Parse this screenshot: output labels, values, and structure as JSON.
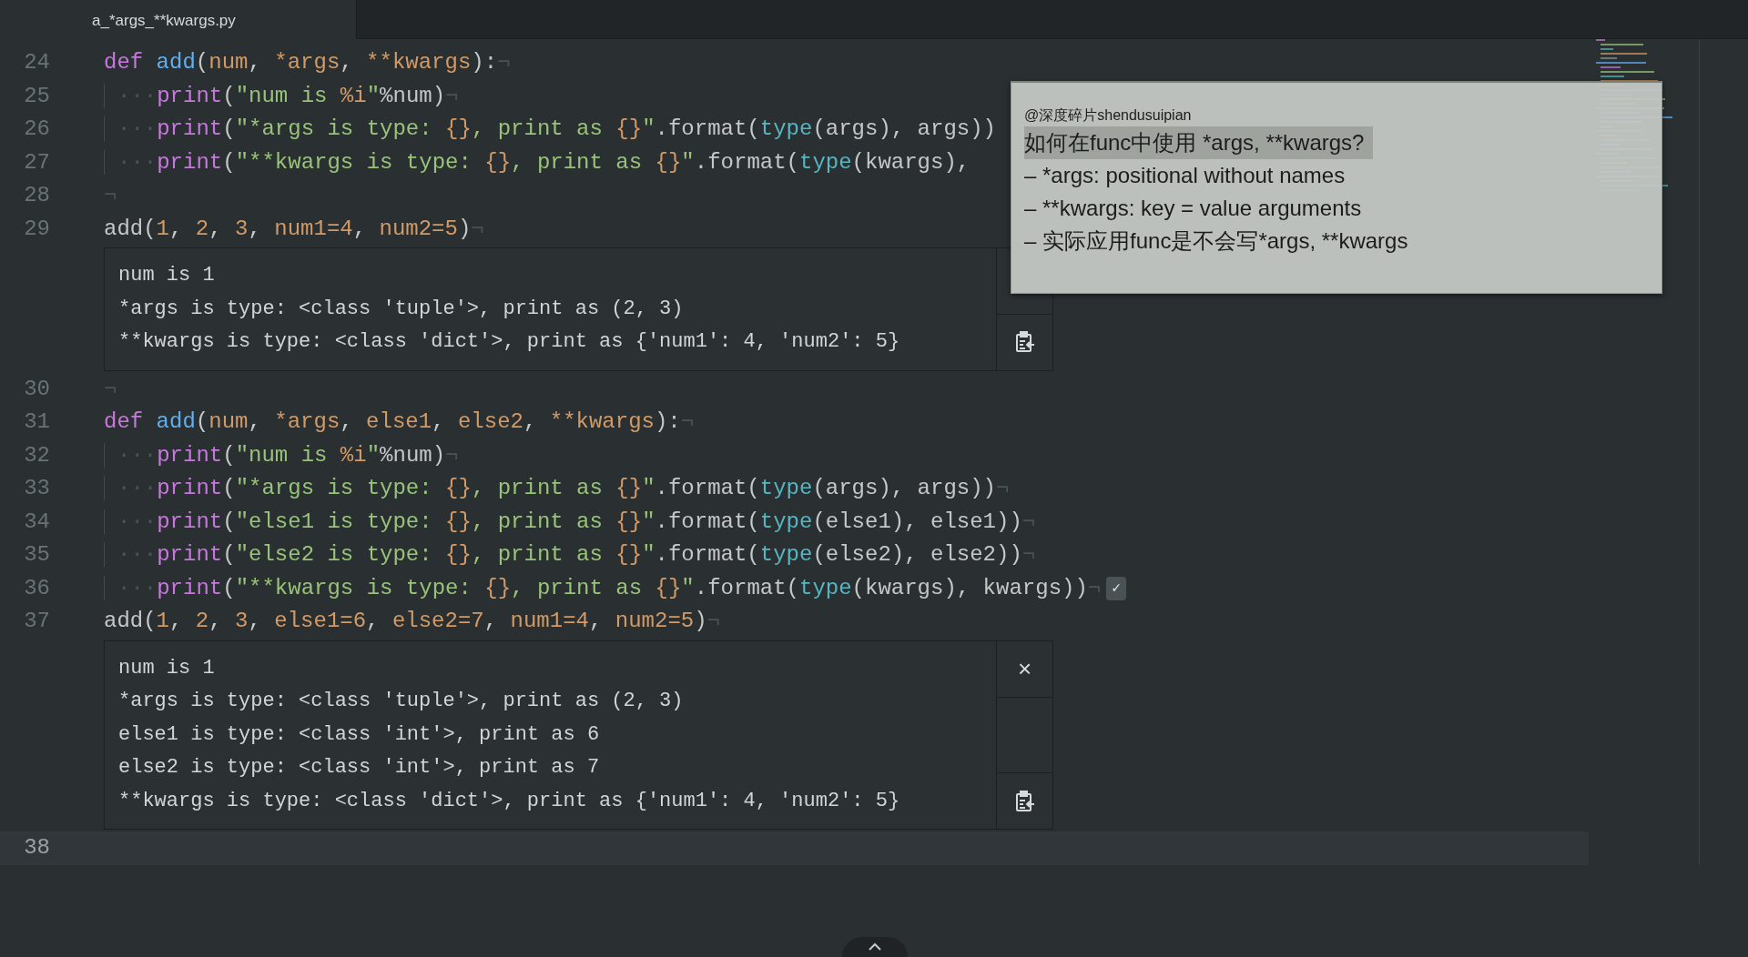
{
  "tabs": [
    {
      "title": "a_*args_**kwargs.py",
      "selected": true
    }
  ],
  "editor": {
    "lines": [
      {
        "kind": "code",
        "number": "24",
        "cursor": false,
        "tokens": [
          {
            "kind": "keyword",
            "text": "def "
          },
          {
            "kind": "function",
            "text": "add"
          },
          {
            "kind": "plain",
            "text": "("
          },
          {
            "kind": "param",
            "text": "num"
          },
          {
            "kind": "plain",
            "text": ", "
          },
          {
            "kind": "param",
            "text": "*args"
          },
          {
            "kind": "plain",
            "text": ", "
          },
          {
            "kind": "param",
            "text": "**kwargs"
          },
          {
            "kind": "plain",
            "text": "):"
          }
        ],
        "eol": "¬"
      },
      {
        "kind": "code",
        "number": "25",
        "cursor": false,
        "indent": "···",
        "tokens": [
          {
            "kind": "call",
            "text": "print"
          },
          {
            "kind": "plain",
            "text": "("
          },
          {
            "kind": "string",
            "text": "\"num is "
          },
          {
            "kind": "number",
            "text": "%i"
          },
          {
            "kind": "string",
            "text": "\""
          },
          {
            "kind": "plain",
            "text": "%num)"
          }
        ],
        "eol": "¬"
      },
      {
        "kind": "code",
        "number": "26",
        "cursor": false,
        "indent": "···",
        "tokens": [
          {
            "kind": "call",
            "text": "print"
          },
          {
            "kind": "plain",
            "text": "("
          },
          {
            "kind": "string",
            "text": "\"*args is type: "
          },
          {
            "kind": "number",
            "text": "{}"
          },
          {
            "kind": "string",
            "text": ", print as "
          },
          {
            "kind": "number",
            "text": "{}"
          },
          {
            "kind": "string",
            "text": "\""
          },
          {
            "kind": "plain",
            "text": ".format("
          },
          {
            "kind": "builtin",
            "text": "type"
          },
          {
            "kind": "plain",
            "text": "(args), args))"
          }
        ]
      },
      {
        "kind": "code",
        "number": "27",
        "cursor": false,
        "indent": "···",
        "tokens": [
          {
            "kind": "call",
            "text": "print"
          },
          {
            "kind": "plain",
            "text": "("
          },
          {
            "kind": "string",
            "text": "\"**kwargs is type: "
          },
          {
            "kind": "number",
            "text": "{}"
          },
          {
            "kind": "string",
            "text": ", print as "
          },
          {
            "kind": "number",
            "text": "{}"
          },
          {
            "kind": "string",
            "text": "\""
          },
          {
            "kind": "plain",
            "text": ".format("
          },
          {
            "kind": "builtin",
            "text": "type"
          },
          {
            "kind": "plain",
            "text": "(kwargs),"
          }
        ]
      },
      {
        "kind": "code",
        "number": "28",
        "cursor": false,
        "eol": "¬"
      },
      {
        "kind": "code",
        "number": "29",
        "cursor": false,
        "tokens": [
          {
            "kind": "plain",
            "text": "add("
          },
          {
            "kind": "number",
            "text": "1"
          },
          {
            "kind": "plain",
            "text": ", "
          },
          {
            "kind": "number",
            "text": "2"
          },
          {
            "kind": "plain",
            "text": ", "
          },
          {
            "kind": "number",
            "text": "3"
          },
          {
            "kind": "plain",
            "text": ", "
          },
          {
            "kind": "param",
            "text": "num1="
          },
          {
            "kind": "number",
            "text": "4"
          },
          {
            "kind": "plain",
            "text": ", "
          },
          {
            "kind": "param",
            "text": "num2="
          },
          {
            "kind": "number",
            "text": "5"
          },
          {
            "kind": "plain",
            "text": ")"
          }
        ],
        "eol": "¬"
      },
      {
        "kind": "output",
        "lines": [
          "num is 1",
          "*args is type: <class 'tuple'>, print as (2, 3)",
          "**kwargs is type: <class 'dict'>, print as {'num1': 4, 'num2': 5}"
        ]
      },
      {
        "kind": "code",
        "number": "30",
        "cursor": false,
        "eol": "¬"
      },
      {
        "kind": "code",
        "number": "31",
        "cursor": false,
        "tokens": [
          {
            "kind": "keyword",
            "text": "def "
          },
          {
            "kind": "function",
            "text": "add"
          },
          {
            "kind": "plain",
            "text": "("
          },
          {
            "kind": "param",
            "text": "num"
          },
          {
            "kind": "plain",
            "text": ", "
          },
          {
            "kind": "param",
            "text": "*args"
          },
          {
            "kind": "plain",
            "text": ", "
          },
          {
            "kind": "param",
            "text": "else1"
          },
          {
            "kind": "plain",
            "text": ", "
          },
          {
            "kind": "param",
            "text": "else2"
          },
          {
            "kind": "plain",
            "text": ", "
          },
          {
            "kind": "param",
            "text": "**kwargs"
          },
          {
            "kind": "plain",
            "text": "):"
          }
        ],
        "eol": "¬"
      },
      {
        "kind": "code",
        "number": "32",
        "cursor": false,
        "indent": "···",
        "tokens": [
          {
            "kind": "call",
            "text": "print"
          },
          {
            "kind": "plain",
            "text": "("
          },
          {
            "kind": "string",
            "text": "\"num is "
          },
          {
            "kind": "number",
            "text": "%i"
          },
          {
            "kind": "string",
            "text": "\""
          },
          {
            "kind": "plain",
            "text": "%num)"
          }
        ],
        "eol": "¬"
      },
      {
        "kind": "code",
        "number": "33",
        "cursor": false,
        "indent": "···",
        "tokens": [
          {
            "kind": "call",
            "text": "print"
          },
          {
            "kind": "plain",
            "text": "("
          },
          {
            "kind": "string",
            "text": "\"*args is type: "
          },
          {
            "kind": "number",
            "text": "{}"
          },
          {
            "kind": "string",
            "text": ", print as "
          },
          {
            "kind": "number",
            "text": "{}"
          },
          {
            "kind": "string",
            "text": "\""
          },
          {
            "kind": "plain",
            "text": ".format("
          },
          {
            "kind": "builtin",
            "text": "type"
          },
          {
            "kind": "plain",
            "text": "(args), args))"
          }
        ],
        "eol": "¬"
      },
      {
        "kind": "code",
        "number": "34",
        "cursor": false,
        "indent": "···",
        "tokens": [
          {
            "kind": "call",
            "text": "print"
          },
          {
            "kind": "plain",
            "text": "("
          },
          {
            "kind": "string",
            "text": "\"else1 is type: "
          },
          {
            "kind": "number",
            "text": "{}"
          },
          {
            "kind": "string",
            "text": ", print as "
          },
          {
            "kind": "number",
            "text": "{}"
          },
          {
            "kind": "string",
            "text": "\""
          },
          {
            "kind": "plain",
            "text": ".format("
          },
          {
            "kind": "builtin",
            "text": "type"
          },
          {
            "kind": "plain",
            "text": "(else1), else1))"
          }
        ],
        "eol": "¬"
      },
      {
        "kind": "code",
        "number": "35",
        "cursor": false,
        "indent": "···",
        "tokens": [
          {
            "kind": "call",
            "text": "print"
          },
          {
            "kind": "plain",
            "text": "("
          },
          {
            "kind": "string",
            "text": "\"else2 is type: "
          },
          {
            "kind": "number",
            "text": "{}"
          },
          {
            "kind": "string",
            "text": ", print as "
          },
          {
            "kind": "number",
            "text": "{}"
          },
          {
            "kind": "string",
            "text": "\""
          },
          {
            "kind": "plain",
            "text": ".format("
          },
          {
            "kind": "builtin",
            "text": "type"
          },
          {
            "kind": "plain",
            "text": "(else2), else2))"
          }
        ],
        "eol": "¬"
      },
      {
        "kind": "code",
        "number": "36",
        "cursor": false,
        "indent": "···",
        "tokens": [
          {
            "kind": "call",
            "text": "print"
          },
          {
            "kind": "plain",
            "text": "("
          },
          {
            "kind": "string",
            "text": "\"**kwargs is type: "
          },
          {
            "kind": "number",
            "text": "{}"
          },
          {
            "kind": "string",
            "text": ", print as "
          },
          {
            "kind": "number",
            "text": "{}"
          },
          {
            "kind": "string",
            "text": "\""
          },
          {
            "kind": "plain",
            "text": ".format("
          },
          {
            "kind": "builtin",
            "text": "type"
          },
          {
            "kind": "plain",
            "text": "(kwargs), kwargs))"
          }
        ],
        "eol": "¬",
        "run_mark": "✓"
      },
      {
        "kind": "code",
        "number": "37",
        "cursor": false,
        "tokens": [
          {
            "kind": "plain",
            "text": "add("
          },
          {
            "kind": "number",
            "text": "1"
          },
          {
            "kind": "plain",
            "text": ", "
          },
          {
            "kind": "number",
            "text": "2"
          },
          {
            "kind": "plain",
            "text": ", "
          },
          {
            "kind": "number",
            "text": "3"
          },
          {
            "kind": "plain",
            "text": ", "
          },
          {
            "kind": "param",
            "text": "else1="
          },
          {
            "kind": "number",
            "text": "6"
          },
          {
            "kind": "plain",
            "text": ", "
          },
          {
            "kind": "param",
            "text": "else2="
          },
          {
            "kind": "number",
            "text": "7"
          },
          {
            "kind": "plain",
            "text": ", "
          },
          {
            "kind": "param",
            "text": "num1="
          },
          {
            "kind": "number",
            "text": "4"
          },
          {
            "kind": "plain",
            "text": ", "
          },
          {
            "kind": "param",
            "text": "num2="
          },
          {
            "kind": "number",
            "text": "5"
          },
          {
            "kind": "plain",
            "text": ")"
          }
        ],
        "eol": "¬"
      },
      {
        "kind": "output",
        "close": "×",
        "lines": [
          "num is 1",
          "*args is type: <class 'tuple'>, print as (2, 3)",
          "else1 is type: <class 'int'>, print as 6",
          "else2 is type: <class 'int'>, print as 7",
          "**kwargs is type: <class 'dict'>, print as {'num1': 4, 'num2': 5}"
        ]
      },
      {
        "kind": "code",
        "number": "38",
        "cursor": true
      }
    ]
  },
  "note": {
    "handle": "@深度碎片shendusuipian",
    "lines": [
      {
        "text": "如何在func中使用 *args, **kwargs?",
        "highlighted": true
      },
      {
        "text": "– *args: positional without names",
        "highlighted": false
      },
      {
        "text": "– **kwargs: key = value arguments",
        "highlighted": false
      },
      {
        "text": "– 实际应用func是不会写*args, **kwargs",
        "highlighted": false
      }
    ]
  }
}
